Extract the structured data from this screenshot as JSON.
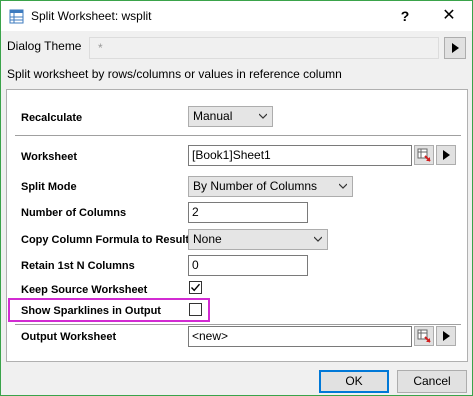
{
  "window": {
    "title": "Split Worksheet: wsplit",
    "help_label": "?",
    "close_label": "✕"
  },
  "theme": {
    "label": "Dialog Theme",
    "value": "*"
  },
  "description": "Split worksheet by rows/columns or values in reference column",
  "form": {
    "recalculate": {
      "label": "Recalculate",
      "value": "Manual"
    },
    "worksheet": {
      "label": "Worksheet",
      "value": "[Book1]Sheet1"
    },
    "split_mode": {
      "label": "Split Mode",
      "value": "By Number of Columns"
    },
    "num_columns": {
      "label": "Number of Columns",
      "value": "2"
    },
    "copy_formula": {
      "label": "Copy Column Formula to Result",
      "value": "None"
    },
    "retain_cols": {
      "label": "Retain 1st N Columns",
      "value": "0"
    },
    "keep_source": {
      "label": "Keep Source Worksheet",
      "checked": true
    },
    "show_sparklines": {
      "label": "Show Sparklines in Output",
      "checked": false
    },
    "output_worksheet": {
      "label": "Output Worksheet",
      "value": "<new>"
    }
  },
  "buttons": {
    "ok": "OK",
    "cancel": "Cancel"
  },
  "colors": {
    "highlight": "#d22bd2",
    "window_border": "#3aa34a",
    "default_button": "#0078d7"
  }
}
